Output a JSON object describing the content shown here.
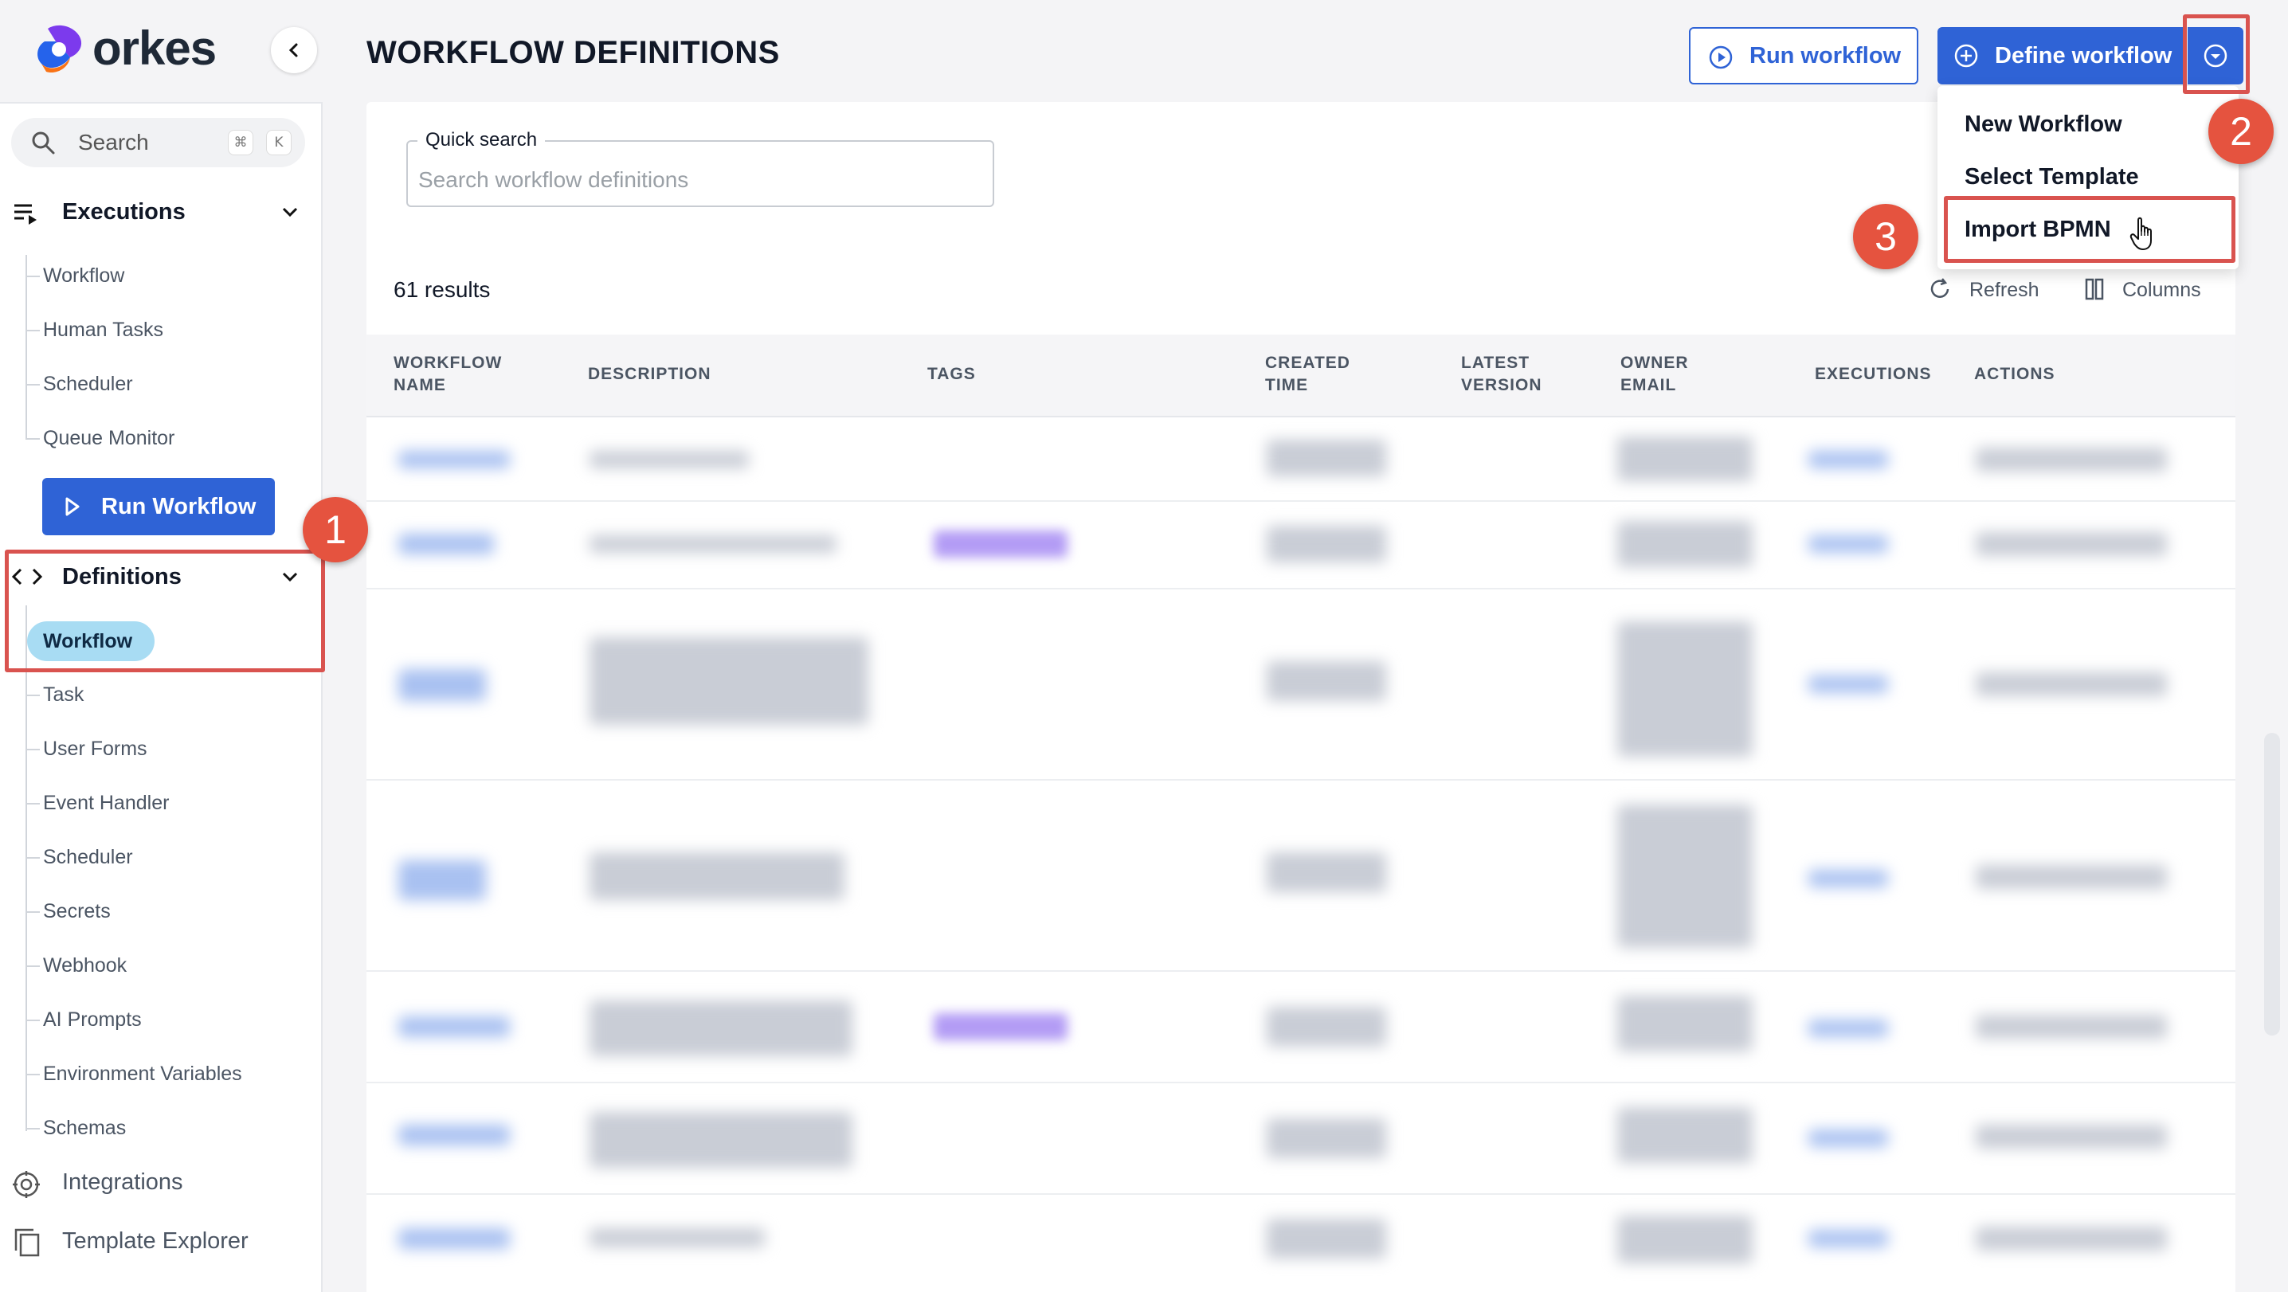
{
  "brand": {
    "name": "orkes"
  },
  "header": {
    "title": "WORKFLOW DEFINITIONS",
    "run_workflow_label": "Run workflow",
    "define_workflow_label": "Define workflow"
  },
  "dropdown_menu": {
    "items": [
      {
        "label": "New Workflow"
      },
      {
        "label": "Select Template"
      },
      {
        "label": "Import BPMN"
      }
    ]
  },
  "sidebar": {
    "search": {
      "label": "Search",
      "shortcut": [
        "⌘",
        "K"
      ]
    },
    "executions": {
      "label": "Executions",
      "items": [
        {
          "label": "Workflow"
        },
        {
          "label": "Human Tasks"
        },
        {
          "label": "Scheduler"
        },
        {
          "label": "Queue Monitor"
        }
      ]
    },
    "run_workflow_label": "Run Workflow",
    "definitions": {
      "label": "Definitions",
      "items": [
        {
          "label": "Workflow",
          "selected": true
        },
        {
          "label": "Task"
        },
        {
          "label": "User Forms"
        },
        {
          "label": "Event Handler"
        },
        {
          "label": "Scheduler"
        },
        {
          "label": "Secrets"
        },
        {
          "label": "Webhook"
        },
        {
          "label": "AI Prompts"
        },
        {
          "label": "Environment Variables"
        },
        {
          "label": "Schemas"
        }
      ]
    },
    "bottom": [
      {
        "label": "Integrations",
        "icon": "integrations-icon"
      },
      {
        "label": "Template Explorer",
        "icon": "template-icon"
      }
    ]
  },
  "main": {
    "quick_search": {
      "label": "Quick search",
      "placeholder": "Search workflow definitions"
    },
    "results_text": "61 results",
    "refresh_label": "Refresh",
    "columns_label": "Columns",
    "table": {
      "headers": [
        {
          "line1": "WORKFLOW",
          "line2": "NAME"
        },
        {
          "line1": "DESCRIPTION",
          "line2": ""
        },
        {
          "line1": "TAGS",
          "line2": ""
        },
        {
          "line1": "CREATED",
          "line2": "TIME"
        },
        {
          "line1": "LATEST",
          "line2": "VERSION"
        },
        {
          "line1": "OWNER",
          "line2": "EMAIL"
        },
        {
          "line1": "EXECUTIONS",
          "line2": ""
        },
        {
          "line1": "ACTIONS",
          "line2": ""
        }
      ]
    }
  },
  "annotations": {
    "steps": [
      "1",
      "2",
      "3"
    ]
  },
  "colors": {
    "primary": "#2f63d6",
    "highlight": "#d9534f",
    "badge": "#e5533f",
    "selected_pill": "#a8dcf3"
  }
}
